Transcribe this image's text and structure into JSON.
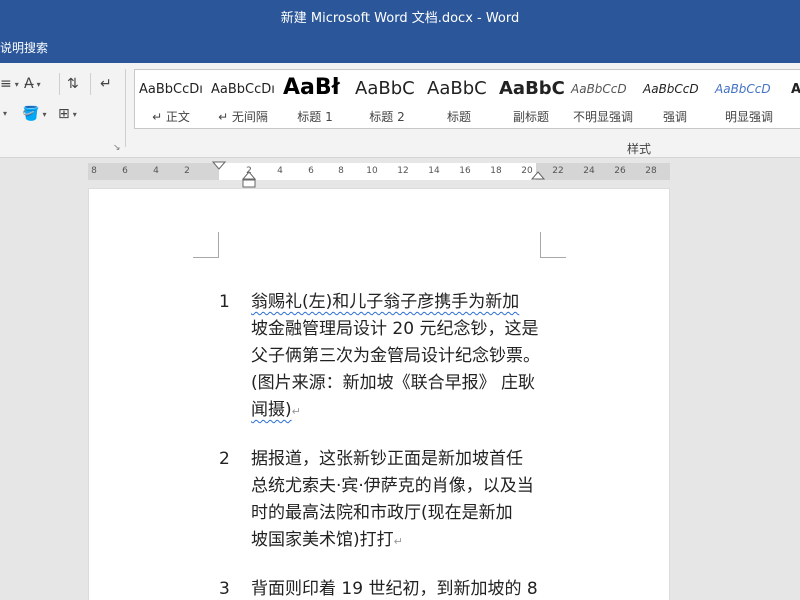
{
  "window": {
    "title": "新建 Microsoft Word 文档.docx  -  Word"
  },
  "menubar": {
    "tell_me": "说明搜索"
  },
  "ribbon": {
    "group_label": "样式",
    "launcher": "↘",
    "styles": [
      {
        "preview": "AaBbCcDı",
        "label": "↵ 正文"
      },
      {
        "preview": "AaBbCcDı",
        "label": "↵ 无间隔"
      },
      {
        "preview": "AaBł",
        "label": "标题 1"
      },
      {
        "preview": "AaBbC",
        "label": "标题 2"
      },
      {
        "preview": "AaBbC",
        "label": "标题"
      },
      {
        "preview": "AaBbC",
        "label": "副标题"
      },
      {
        "preview": "AaBbCcD",
        "label": "不明显强调"
      },
      {
        "preview": "AaBbCcD",
        "label": "强调"
      },
      {
        "preview": "AaBbCcD",
        "label": "明显强调"
      },
      {
        "preview": "A",
        "label": ""
      }
    ]
  },
  "ruler": {
    "ticks": [
      "8",
      "6",
      "4",
      "2",
      "2",
      "4",
      "6",
      "8",
      "10",
      "12",
      "14",
      "16",
      "18",
      "20",
      "22",
      "24",
      "26",
      "28"
    ]
  },
  "document": {
    "paragraphs": [
      {
        "num": "1",
        "lines": [
          "翁赐礼(左)和儿子翁子彦携手为新加",
          "坡金融管理局设计 20 元纪念钞，这是",
          "父子俩第三次为金管局设计纪念钞票。",
          "(图片来源：新加坡《联合早报》 庄耿",
          "闻摄)"
        ]
      },
      {
        "num": "2",
        "lines": [
          "据报道，这张新钞正面是新加坡首任",
          "总统尤索夫·宾·伊萨克的肖像，以及当",
          "时的最高法院和市政厅(现在是新加",
          "坡国家美术馆)打打"
        ]
      },
      {
        "num": "3",
        "lines": [
          "背面则印着 19 世纪初，到新加坡的 8"
        ]
      }
    ]
  },
  "colors": {
    "accent": "#2b579a",
    "spell": "#2b6fd6"
  }
}
